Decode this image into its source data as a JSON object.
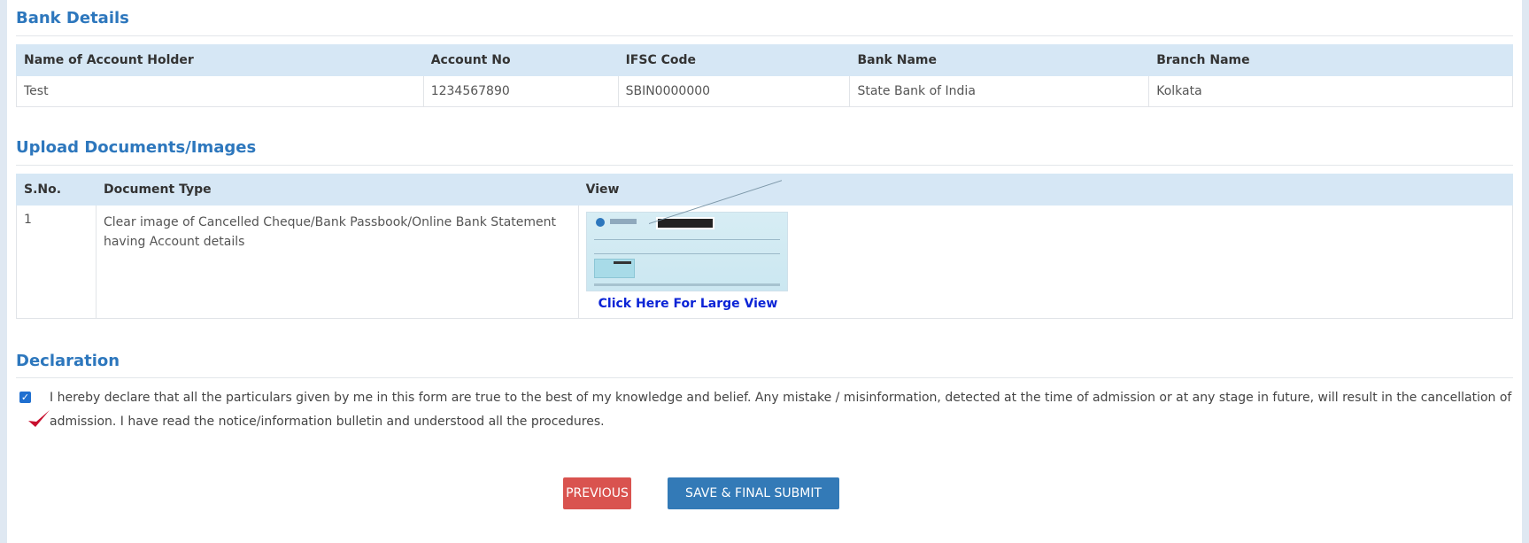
{
  "bank": {
    "title": "Bank Details",
    "headers": [
      "Name of Account Holder",
      "Account No",
      "IFSC Code",
      "Bank Name",
      "Branch Name"
    ],
    "row": [
      "Test",
      "1234567890",
      "SBIN0000000",
      "State Bank of India",
      "Kolkata"
    ]
  },
  "upload": {
    "title": "Upload Documents/Images",
    "headers": [
      "S.No.",
      "Document Type",
      "View"
    ],
    "rows": [
      {
        "sno": "1",
        "doc_type": "Clear image of Cancelled Cheque/Bank Passbook/Online Bank Statement having Account details",
        "link": "Click Here For Large View"
      }
    ]
  },
  "declaration": {
    "title": "Declaration",
    "checked": true,
    "text": "I hereby declare that all the particulars given by me in this form are true to the best of my knowledge and belief. Any mistake / misinformation, detected at the time of admission or at any stage in future, will result in the cancellation of admission. I have read the notice/information bulletin and understood all the procedures."
  },
  "buttons": {
    "previous": "PREVIOUS",
    "submit": "SAVE & FINAL SUBMIT"
  }
}
